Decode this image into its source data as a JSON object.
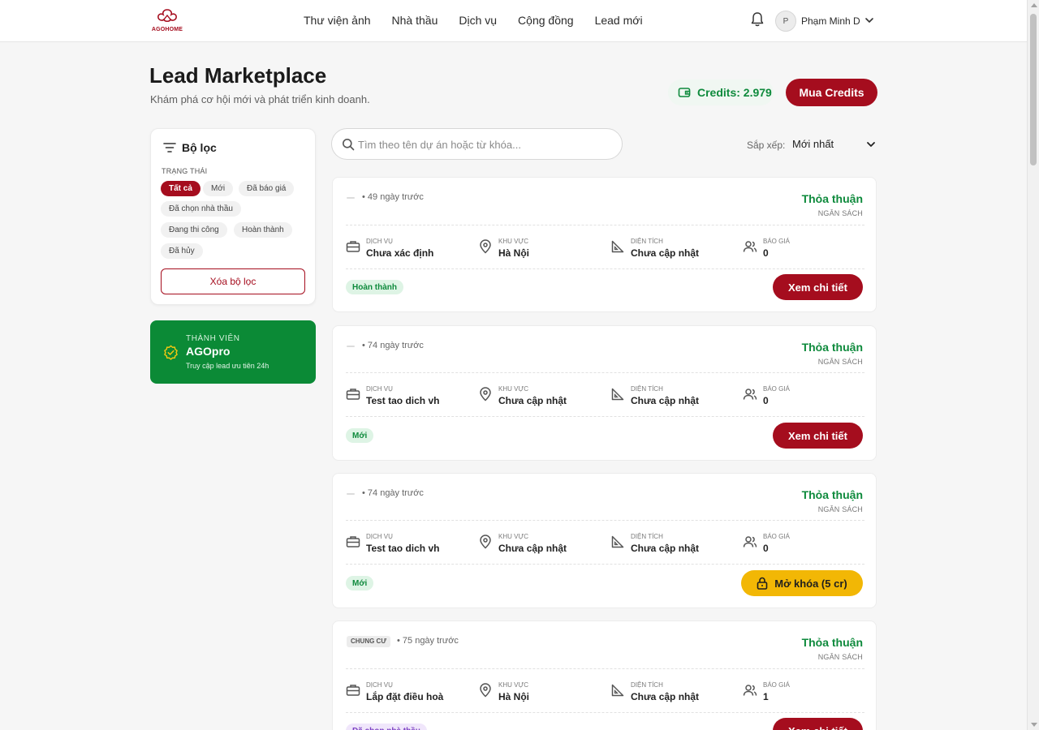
{
  "brand": {
    "name": "AGOHOME"
  },
  "nav": [
    {
      "label": "Thư viện ảnh"
    },
    {
      "label": "Nhà thầu"
    },
    {
      "label": "Dịch vụ"
    },
    {
      "label": "Cộng đồng"
    },
    {
      "label": "Lead mới"
    }
  ],
  "user": {
    "initial": "P",
    "name": "Phạm Minh D"
  },
  "page": {
    "title": "Lead Marketplace",
    "subtitle": "Khám phá cơ hội mới và phát triển kinh doanh.",
    "credits_label": "Credits: 2.979",
    "buy_label": "Mua Credits"
  },
  "filter": {
    "title": "Bộ lọc",
    "status_label": "TRẠNG THÁI",
    "chips": [
      {
        "label": "Tất cả",
        "active": true
      },
      {
        "label": "Mới"
      },
      {
        "label": "Đã báo giá"
      },
      {
        "label": "Đã chọn nhà thầu"
      },
      {
        "label": "Đang thi công"
      },
      {
        "label": "Hoàn thành"
      },
      {
        "label": "Đã hủy"
      }
    ],
    "clear_label": "Xóa bộ lọc"
  },
  "member": {
    "kicker": "THÀNH VIÊN",
    "title": "AGOpro",
    "desc": "Truy cập lead ưu tiên 24h"
  },
  "search": {
    "placeholder": "Tìm theo tên dự án hoặc từ khóa..."
  },
  "sort": {
    "label": "Sắp xếp:",
    "value": "Mới nhất"
  },
  "meta_labels": {
    "service": "DỊCH VỤ",
    "area": "KHU VỰC",
    "size": "DIỆN TÍCH",
    "quotes": "BÁO GIÁ"
  },
  "leads": [
    {
      "tag": "",
      "time": "• 49 ngày trước",
      "budget": "Thỏa thuận",
      "budget_label": "NGÂN SÁCH",
      "service": "Chưa xác định",
      "area": "Hà Nội",
      "size": "Chưa cập nhật",
      "quotes": "0",
      "status": "Hoàn thành",
      "status_color": "#0e8a3c",
      "status_bg": "#def4e5",
      "action": "Xem chi tiết"
    },
    {
      "tag": "",
      "time": "• 74 ngày trước",
      "budget": "Thỏa thuận",
      "budget_label": "NGÂN SÁCH",
      "service": "Test tao dich vh",
      "area": "Chưa cập nhật",
      "size": "Chưa cập nhật",
      "quotes": "0",
      "status": "Mới",
      "status_color": "#0e8a3c",
      "status_bg": "#def4e5",
      "action": "Xem chi tiết"
    },
    {
      "tag": "",
      "time": "• 74 ngày trước",
      "budget": "Thỏa thuận",
      "budget_label": "NGÂN SÁCH",
      "service": "Test tao dich vh",
      "area": "Chưa cập nhật",
      "size": "Chưa cập nhật",
      "quotes": "0",
      "status": "Mới",
      "status_color": "#0e8a3c",
      "status_bg": "#def4e5",
      "action": "Mở khóa (5 cr)"
    },
    {
      "tag": "CHUNG CƯ",
      "time": "• 75 ngày trước",
      "budget": "Thỏa thuận",
      "budget_label": "NGÂN SÁCH",
      "service": "Lắp đặt điều hoà",
      "area": "Hà Nội",
      "size": "Chưa cập nhật",
      "quotes": "1",
      "status": "Đã chọn nhà thầu",
      "status_color": "#7b3fc2",
      "status_bg": "#f0e6fb",
      "action": "Xem chi tiết"
    }
  ],
  "colors": {
    "brand": "#a50d1e",
    "green": "#0e8a3c",
    "unlock": "#f2b705"
  }
}
